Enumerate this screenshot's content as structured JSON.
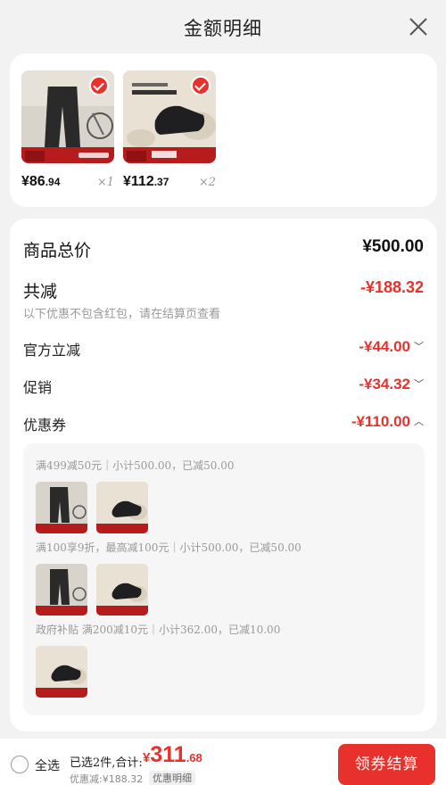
{
  "header": {
    "title": "金额明细"
  },
  "products": [
    {
      "price_int": "¥86",
      "price_dec": ".94",
      "qty": "×1",
      "tag": "115"
    },
    {
      "price_int": "¥112",
      "price_dec": ".37",
      "qty": "×2",
      "tag": "154"
    }
  ],
  "summary": {
    "total_label": "商品总价",
    "total_value": "¥500.00",
    "discount_label": "共减",
    "discount_value": "-¥188.32",
    "note": "以下优惠不包含红包，请在结算页查看",
    "official_label": "官方立减",
    "official_value": "-¥44.00",
    "promo_label": "促销",
    "promo_value": "-¥34.32",
    "coupon_label": "优惠券",
    "coupon_value": "-¥110.00"
  },
  "coupons": {
    "line1": "满499减50元｜小计500.00，已减50.00",
    "line2": "满100享9折，最高减100元｜小计500.00，已减50.00",
    "line3": "政府补贴 满200减10元｜小计362.00，已减10.00"
  },
  "footer": {
    "select_all": "全选",
    "selected_text": "已选2件,合计:",
    "total_currency": "¥",
    "total_int": "311",
    "total_dec": ".68",
    "discount_text": "优惠减:¥188.32",
    "detail_tag": "优惠明细",
    "checkout": "领券结算"
  },
  "colors": {
    "accent": "#e8312c",
    "background": "#f2f2f2"
  }
}
